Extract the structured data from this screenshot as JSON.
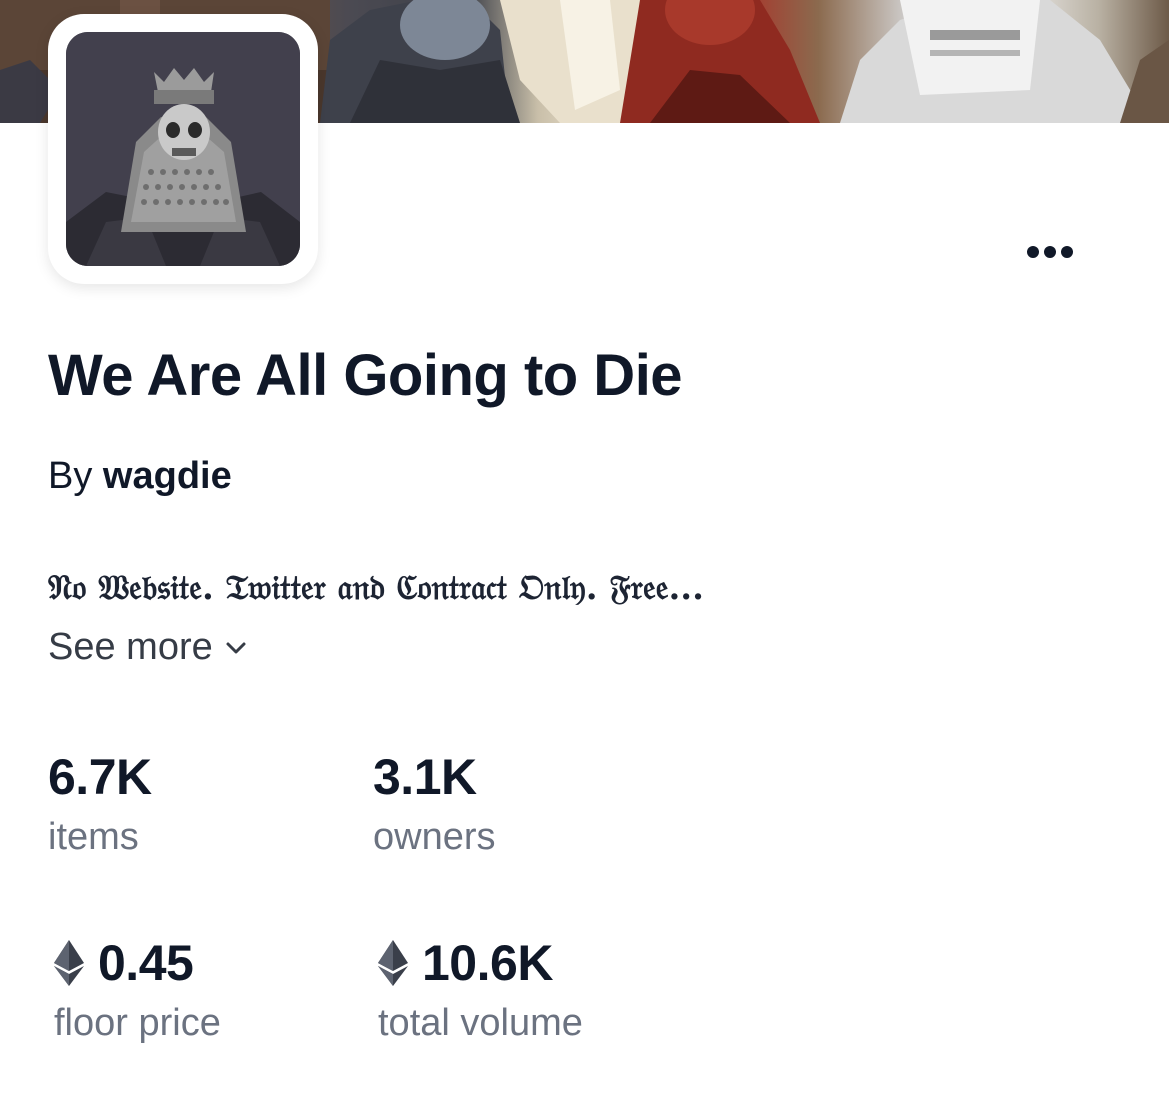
{
  "collection": {
    "name": "We Are All Going to Die",
    "by_prefix": "By",
    "creator": "wagdie",
    "description": "𝔑𝔬 𝔚𝔢𝔟𝔰𝔦𝔱𝔢. 𝔗𝔴𝔦𝔱𝔱𝔢𝔯 𝔞𝔫𝔡 ℭ𝔬𝔫𝔱𝔯𝔞𝔠𝔱 𝔒𝔫𝔩𝔶. 𝔉𝔯𝔢𝔢...",
    "see_more_label": "See more"
  },
  "stats": {
    "items": {
      "value": "6.7K",
      "label": "items"
    },
    "owners": {
      "value": "3.1K",
      "label": "owners"
    },
    "floor_price": {
      "value": "0.45",
      "label": "floor price",
      "currency_icon": "ethereum-icon"
    },
    "total_volume": {
      "value": "10.6K",
      "label": "total volume",
      "currency_icon": "ethereum-icon"
    }
  },
  "icons": {
    "more": "more-horizontal-icon",
    "see_more": "chevron-down-icon"
  },
  "colors": {
    "text_primary": "#101828",
    "text_secondary": "#6b7280",
    "background": "#ffffff"
  }
}
